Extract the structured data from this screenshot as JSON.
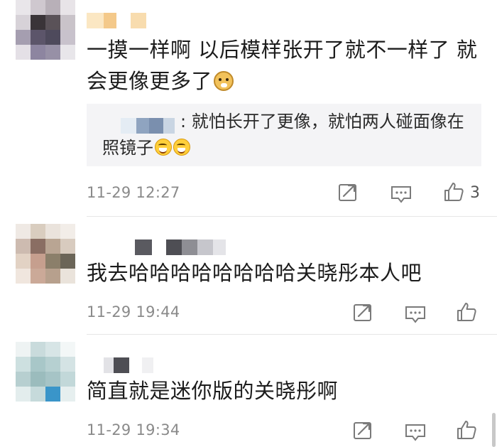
{
  "comments": [
    {
      "text": "一摸一样啊 以后模样张开了就不一样了 就会更像更多了",
      "emoji": "doge-emoji",
      "reply": {
        "prefix": ": ",
        "text": "就怕长开了更像，就怕两人碰面像在照镜子",
        "emoji": "laugh-tears-emoji"
      },
      "timestamp": "11-29 12:27",
      "like_count": "3"
    },
    {
      "text": "我去哈哈哈哈哈哈哈哈关晓彤本人吧",
      "timestamp": "11-29 19:44",
      "like_count": ""
    },
    {
      "text": "简直就是迷你版的关晓彤啊",
      "timestamp": "11-29 19:34",
      "like_count": ""
    }
  ],
  "icons": {
    "share": "share-icon",
    "reply": "comment-icon",
    "like": "thumbs-up-icon"
  },
  "colors": {
    "meta_text": "#8a8a8a",
    "quote_bg": "#f4f4f6",
    "icon": "#7a7a7a"
  }
}
